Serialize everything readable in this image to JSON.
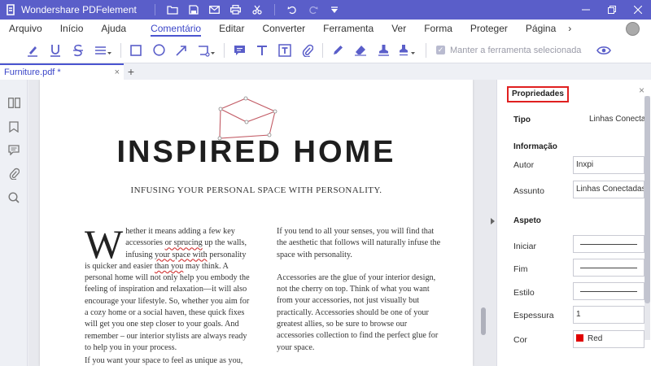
{
  "app": {
    "title": "Wondershare PDFelement"
  },
  "menu": {
    "items": [
      "Arquivo",
      "Início",
      "Ajuda",
      "Comentário",
      "Editar",
      "Converter",
      "Ferramenta",
      "Ver",
      "Forma",
      "Proteger",
      "Página"
    ],
    "active": "Comentário",
    "more": "›"
  },
  "toolbar": {
    "keep_tool_label": "Manter a ferramenta selecionada"
  },
  "tabs": {
    "document": "Furniture.pdf *",
    "close": "×",
    "add": "+"
  },
  "document": {
    "title": "INSPIRED HOME",
    "subtitle": "INFUSING YOUR PERSONAL SPACE WITH PERSONALITY.",
    "col1": {
      "dropcap": "W",
      "p1_a": "hether it means adding a few key accessories ",
      "p1_wavy": "or sprucing",
      "p1_b": " up the walls, infusing ",
      "p1_wavy2": "your space with",
      "p1_c": " personality is quicker and easier ",
      "p1_wavy3": "than you",
      "p1_d": " may think. A personal home will not only help you embody the feeling of inspiration and relaxation—it will also encourage your lifestyle. So, whether you aim for a cozy home or a social haven, these quick fixes will get you one step closer to your goals. And remember – our interior stylists are always ready to help you in your process.",
      "tail": "If you want your space to feel as unique as you,"
    },
    "col2": {
      "p1": "If you tend to all your senses, you will find that the aesthetic that follows will naturally infuse the space with personality.",
      "p2": "Accessories are the glue of your interior design, not the cherry on top. Think of what you want from your accessories, not just visually but practically. Accessories should be one of your greatest allies, so be sure to browse our accessories collection to find the perfect glue for your space."
    }
  },
  "properties": {
    "title": "Propriedades",
    "close": "×",
    "type_label": "Tipo",
    "type_value": "Linhas Conectad",
    "info_section": "Informação",
    "author_label": "Autor",
    "author_value": "Inxpi",
    "subject_label": "Assunto",
    "subject_value": "Linhas Conectadas",
    "appearance_section": "Aspeto",
    "start_label": "Iniciar",
    "end_label": "Fim",
    "style_label": "Estilo",
    "thickness_label": "Espessura",
    "thickness_value": "1",
    "color_label": "Cor",
    "color_value": "Red",
    "color_hex": "#e00000"
  },
  "colors": {
    "accent": "#5a5ec9",
    "shape": "#c25a64"
  }
}
